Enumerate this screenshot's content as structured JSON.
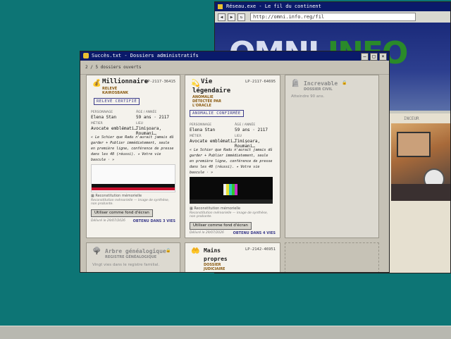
{
  "browser": {
    "title": "Réseau.exe - Le fil du continent",
    "url": "http://omni.info.reg/fil",
    "hero_logo_a": "OMNI",
    "hero_logo_b": "INFO",
    "panel_label": "INCEUR"
  },
  "window": {
    "title": "Succès.txt - Dossiers administratifs",
    "counter": "2 / 5 dossiers ouverts",
    "controls": [
      "–",
      "□",
      "×"
    ]
  },
  "cards": {
    "c1": {
      "name": "Millionnaire",
      "sub": "RELEVÉ KAIROSBANK",
      "sub1": "RELEVÉ",
      "sub2": "KAIROSBANK",
      "ref": "LP-2117-36415",
      "stamp": "RELEVÉ CERTIFIÉ",
      "label_person": "PERSONNAGE",
      "person": "Elena Stan",
      "label_age": "ÂGE / ANNÉE",
      "age": "59 ans · 2117",
      "label_job": "MÉTIER",
      "job": "Avocate emblémati…",
      "label_place": "LIEU",
      "place": "Timișoara, Roumani…",
      "quote": "« Le Schier que Radu n'aurait jamais dû garder + Publier immédiatement, seule en première ligne, conférence de presse dans les 48 (réussi). ✦ Votre vie bascule · »",
      "img_cap": "Reconstitution mémorielle",
      "img_sub": "Reconstitution mémorielle — image de synthèse, non probante.",
      "wp_btn": "Utiliser comme fond d'écran",
      "delivered": "Délivré le 29/07/2026",
      "obtained": "OBTENU DANS 3 VIES"
    },
    "c2": {
      "name1": "Vie",
      "name2": "légendaire",
      "sub1": "ANOMALIE",
      "sub2": "DÉTECTÉE PAR",
      "sub3": "L'ORACLE",
      "ref": "LP-2117-64695",
      "stamp": "ANOMALIE CONFIRMÉE",
      "label_person": "PERSONNAGE",
      "person": "Elena Stan",
      "label_age": "ÂGE / ANNÉE",
      "age": "59 ans · 2117",
      "label_job": "MÉTIER",
      "job": "Avocate emblémati…",
      "label_place": "LIEU",
      "place": "Timișoara, Roumani…",
      "quote": "« Le Schier que Radu n'aurait jamais dû garder + Publier immédiatement, seule en première ligne, conférence de presse dans les 48 (réussi). ✦ Votre vie bascule · »",
      "img_cap": "Reconstitution mémorielle",
      "img_sub": "Reconstitution mémorielle — image de synthèse, non probante.",
      "wp_btn": "Utiliser comme fond d'écran",
      "delivered": "Délivré le 29/07/2026",
      "obtained": "OBTENU DANS 4 VIES"
    },
    "c3": {
      "name": "Increvable",
      "sub": "DOSSIER CIVIL",
      "desc": "Atteindre 90 ans."
    },
    "c4": {
      "name": "Arbre généalogique",
      "sub": "REGISTRE GÉNÉALOGIQUE",
      "desc": "Vingt vies dans le registre familial."
    },
    "c5": {
      "name1": "Mains",
      "name2": "propres",
      "sub1": "DOSSIER",
      "sub2": "JUDICIAIRE",
      "ref": "LP-2142-46951"
    }
  },
  "colors": {
    "desktop": "#0d7575",
    "titlebar": "#0a1a6a",
    "stamp": "#3a3a8a",
    "accent_gold": "#8a5a10"
  }
}
